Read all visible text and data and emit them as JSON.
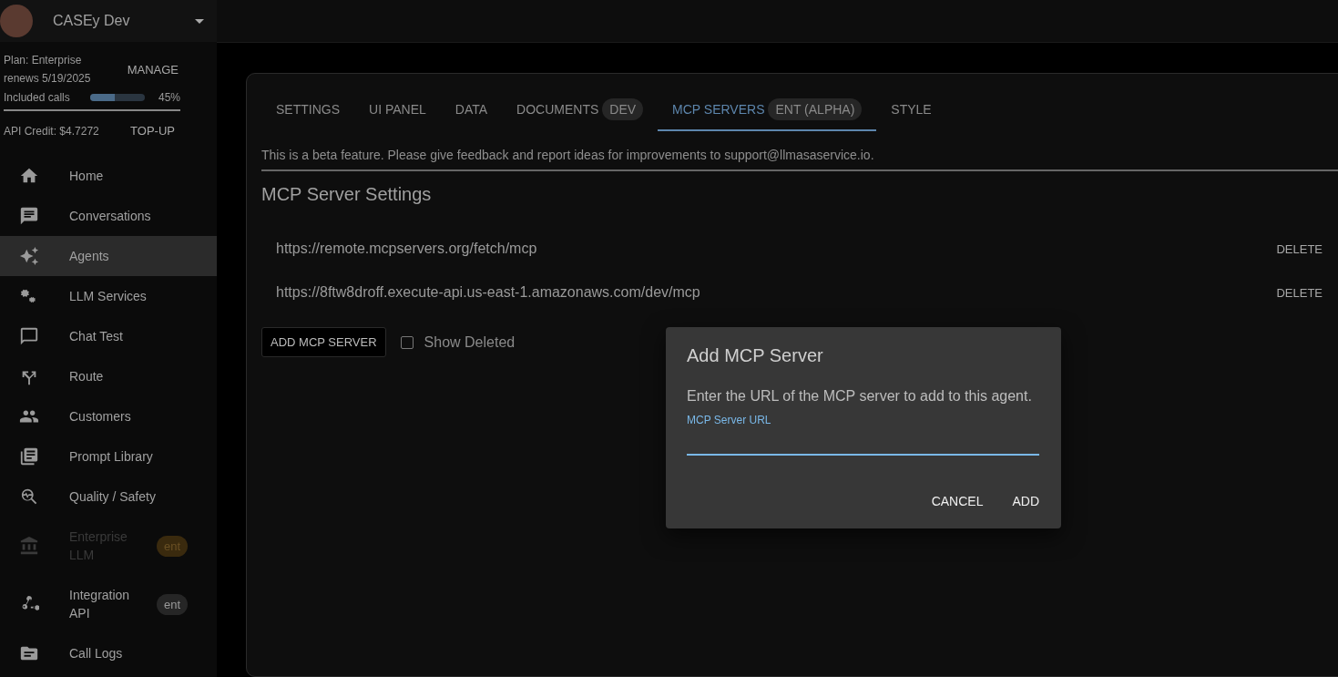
{
  "account": {
    "name": "CASEy Dev",
    "plan": "Plan: Enterprise",
    "renews": "renews 5/19/2025",
    "manage": "MANAGE",
    "usage_label": "Included calls",
    "usage": {
      "level": 0.45
    },
    "usage_reading": "45%",
    "credit": "API Credit: $4.7272",
    "topup": "TOP-UP"
  },
  "sidebar": {
    "items": [
      {
        "label": "Home",
        "selected": false,
        "disabled": false
      },
      {
        "label": "Conversations",
        "selected": false,
        "disabled": false
      },
      {
        "label": "Agents",
        "selected": true,
        "disabled": false
      },
      {
        "label": "LLM Services",
        "selected": false,
        "disabled": false
      },
      {
        "label": "Chat Test",
        "selected": false,
        "disabled": false
      },
      {
        "label": "Route",
        "selected": false,
        "disabled": false
      },
      {
        "label": "Customers",
        "selected": false,
        "disabled": false
      },
      {
        "label": "Prompt Library",
        "selected": false,
        "disabled": false
      },
      {
        "label": "Quality / Safety",
        "selected": false,
        "disabled": false
      },
      {
        "label": "Enterprise LLM",
        "selected": false,
        "disabled": true,
        "badge": {
          "text": "ent",
          "color": "#3a2a0e"
        }
      },
      {
        "label": "Integration API",
        "selected": false,
        "disabled": false,
        "badge": {
          "text": "ent",
          "color": "#262626"
        }
      },
      {
        "label": "Call Logs",
        "selected": false,
        "disabled": false
      }
    ]
  },
  "tabs": [
    {
      "label": "SETTINGS",
      "selected": false
    },
    {
      "label": "UI PANEL",
      "selected": false
    },
    {
      "label": "DATA",
      "selected": false
    },
    {
      "label": "DOCUMENTS",
      "badge": "DEV",
      "selected": false
    },
    {
      "label": "MCP SERVERS",
      "badge": "ENT (ALPHA)",
      "selected": true
    },
    {
      "label": "STYLE",
      "selected": false
    }
  ],
  "notice": "This is a beta feature. Please give feedback and report ideas for improvements to support@llmasaservice.io.",
  "heading": "MCP Server Settings",
  "servers": [
    {
      "url": "https://remote.mcpservers.org/fetch/mcp",
      "action": "DELETE"
    },
    {
      "url": "https://8ftw8droff.execute-api.us-east-1.amazonaws.com/dev/mcp",
      "action": "DELETE"
    }
  ],
  "add_button": "ADD MCP SERVER",
  "show_deleted": {
    "label": "Show Deleted",
    "checked": false
  },
  "dialog": {
    "title": "Add MCP Server",
    "text": "Enter the URL of the MCP server to add to this agent.",
    "field_label": "MCP Server URL",
    "buttons": [
      "CANCEL",
      "ADD"
    ]
  }
}
